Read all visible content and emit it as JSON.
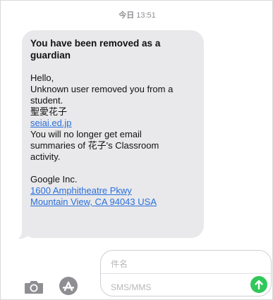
{
  "header": {
    "day": "今日",
    "time": "13:51"
  },
  "message": {
    "title_line1": "You have been removed as a",
    "title_line2": "guardian",
    "greeting": "Hello,",
    "line1": "Unknown user removed you from a",
    "line2": "student.",
    "student_name": "聖愛花子",
    "link": "seiai.ed.jp",
    "line3": "You will no longer get email",
    "line4": "summaries of 花子's Classroom",
    "line5": "activity.",
    "company": "Google Inc.",
    "address1": "1600 Amphitheatre Pkwy",
    "address2": "Mountain View, CA 94043 USA"
  },
  "composer": {
    "subject_placeholder": "件名",
    "body_placeholder": "SMS/MMS",
    "icons": [
      "camera-icon",
      "app-store-icon",
      "send-arrow-icon"
    ],
    "send_color": "#31c75a"
  },
  "colors": {
    "bubble": "#e9e9eb",
    "link": "#2a6fdb",
    "timestamp": "#8e8e93"
  }
}
